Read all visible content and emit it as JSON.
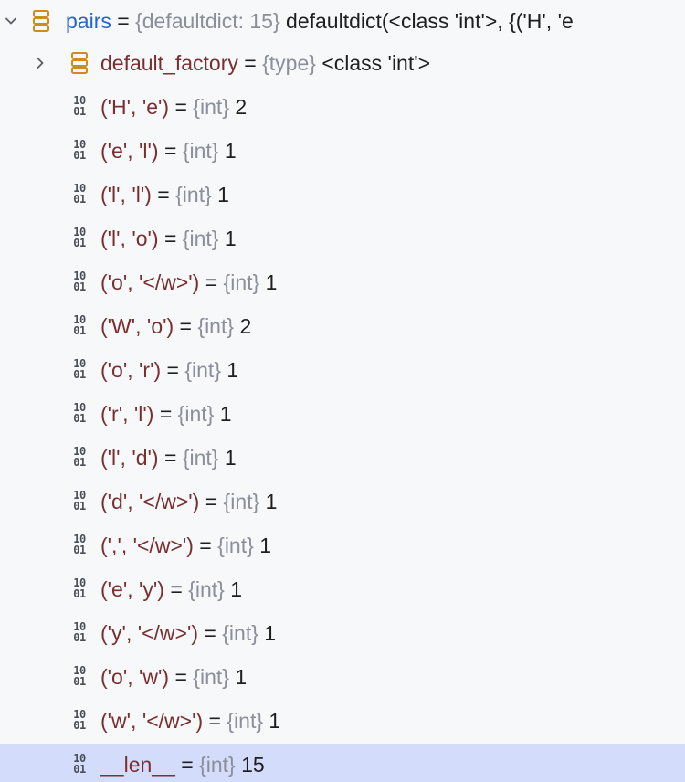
{
  "variable": {
    "name": "pairs",
    "equals": " = ",
    "type": "{defaultdict: 15}",
    "value": "defaultdict(<class 'int'>, {('H', 'e"
  },
  "default_factory": {
    "name": "default_factory",
    "equals": " = ",
    "type": "{type}",
    "value": "<class 'int'>"
  },
  "entries": [
    {
      "key": "('H', 'e')",
      "equals": " = ",
      "type": "{int}",
      "value": "2"
    },
    {
      "key": "('e', 'l')",
      "equals": " = ",
      "type": "{int}",
      "value": "1"
    },
    {
      "key": "('l', 'l')",
      "equals": " = ",
      "type": "{int}",
      "value": "1"
    },
    {
      "key": "('l', 'o')",
      "equals": " = ",
      "type": "{int}",
      "value": "1"
    },
    {
      "key": "('o', '</w>')",
      "equals": " = ",
      "type": "{int}",
      "value": "1"
    },
    {
      "key": "('W', 'o')",
      "equals": " = ",
      "type": "{int}",
      "value": "2"
    },
    {
      "key": "('o', 'r')",
      "equals": " = ",
      "type": "{int}",
      "value": "1"
    },
    {
      "key": "('r', 'l')",
      "equals": " = ",
      "type": "{int}",
      "value": "1"
    },
    {
      "key": "('l', 'd')",
      "equals": " = ",
      "type": "{int}",
      "value": "1"
    },
    {
      "key": "('d', '</w>')",
      "equals": " = ",
      "type": "{int}",
      "value": "1"
    },
    {
      "key": "(',', '</w>')",
      "equals": " = ",
      "type": "{int}",
      "value": "1"
    },
    {
      "key": "('e', 'y')",
      "equals": " = ",
      "type": "{int}",
      "value": "1"
    },
    {
      "key": "('y', '</w>')",
      "equals": " = ",
      "type": "{int}",
      "value": "1"
    },
    {
      "key": "('o', 'w')",
      "equals": " = ",
      "type": "{int}",
      "value": "1"
    },
    {
      "key": "('w', '</w>')",
      "equals": " = ",
      "type": "{int}",
      "value": "1"
    }
  ],
  "len_row": {
    "key": "__len__",
    "equals": " = ",
    "type": "{int}",
    "value": "15",
    "selected": true
  },
  "icons": {
    "expanded": "chevron-down-icon",
    "collapsed": "chevron-right-icon",
    "object": "object-layers-icon",
    "primitive": "binary-value-icon",
    "binary_top": "10",
    "binary_bottom": "01"
  },
  "colors": {
    "background": "#f7f8fa",
    "selection": "#d3dcfb",
    "field_name": "#2a64c8",
    "key_name": "#7a2f2f",
    "type_text": "#8a8f99",
    "object_icon": "#d08c1a"
  }
}
